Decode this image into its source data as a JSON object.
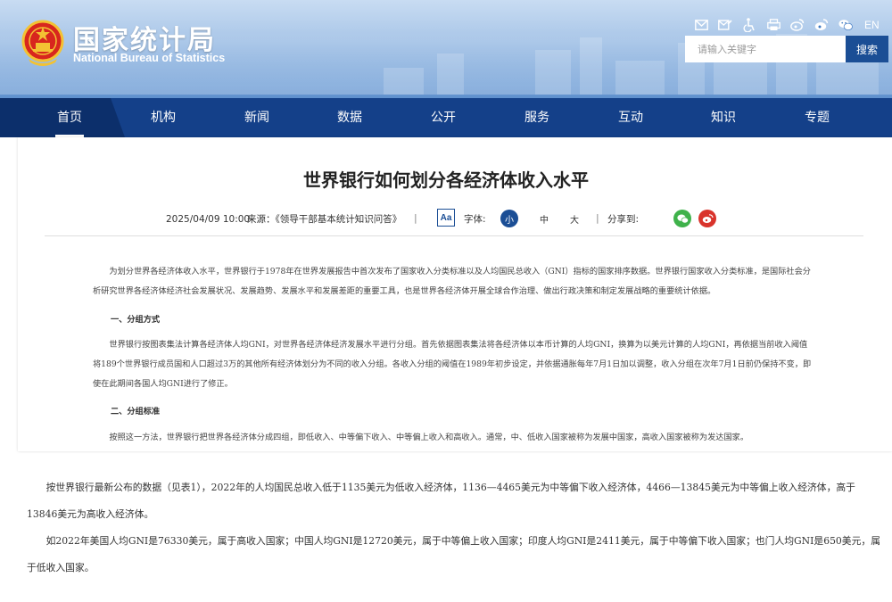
{
  "header": {
    "logo_cn": "国家统计局",
    "logo_en": "National Bureau of Statistics",
    "lang": "EN",
    "icons": [
      "mail-icon",
      "edit-mail-icon",
      "accessibility-icon",
      "print-icon",
      "weibo-icon",
      "weibo-alt-icon",
      "wechat-icon"
    ],
    "search_placeholder": "请输入关键字",
    "search_button": "搜索"
  },
  "nav": {
    "items": [
      "首页",
      "机构",
      "新闻",
      "数据",
      "公开",
      "服务",
      "互动",
      "知识",
      "专题"
    ],
    "active": "首页"
  },
  "article": {
    "title": "世界银行如何划分各经济体收入水平",
    "date": "2025/04/09 10:00",
    "source": "来源：《领导干部基本统计知识问答》",
    "font_size_label": "字体:",
    "aa_label": "Aa",
    "font_sizes": [
      "小",
      "中",
      "大"
    ],
    "share_label": "分享到:",
    "paragraphs_small": [
      "为划分世界各经济体收入水平，世界银行于1978年在世界发展报告中首次发布了国家收入分类标准以及人均国民总收入（GNI）指标的国家排序数据。世界银行国家收入分类标准，是国际社会分析研究世界各经济体经济社会发展状况、发展趋势、发展水平和发展差距的重要工具，也是世界各经济体开展全球合作治理、做出行政决策和制定发展战略的重要统计依据。",
      "世界银行按图表集法计算各经济体人均GNI，对世界各经济体经济发展水平进行分组。首先依据图表集法将各经济体以本币计算的人均GNI，换算为以美元计算的人均GNI，再依据当前收入阈值将189个世界银行成员国和人口超过3万的其他所有经济体划分为不同的收入分组。各收入分组的阈值在1989年初步设定，并依据通胀每年7月1日加以调整，收入分组在次年7月1日前仍保持不变，即使在此期间各国人均GNI进行了修正。",
      "按照这一方法，世界银行把世界各经济体分成四组，即低收入、中等偏下收入、中等偏上收入和高收入。通常，中、低收入国家被称为发展中国家，高收入国家被称为发达国家。"
    ],
    "headings": [
      "一、分组方式",
      "二、分组标准"
    ],
    "paragraphs_big": [
      "按世界银行最新公布的数据（见表1），2022年的人均国民总收入低于1135美元为低收入经济体，1136—4465美元为中等偏下收入经济体，4466—13845美元为中等偏上收入经济体，高于13846美元为高收入经济体。",
      "如2022年美国人均GNI是76330美元，属于高收入国家；中国人均GNI是12720美元，属于中等偏上收入国家；印度人均GNI是2411美元，属于中等偏下收入国家；也门人均GNI是650美元，属于低收入国家。"
    ]
  }
}
